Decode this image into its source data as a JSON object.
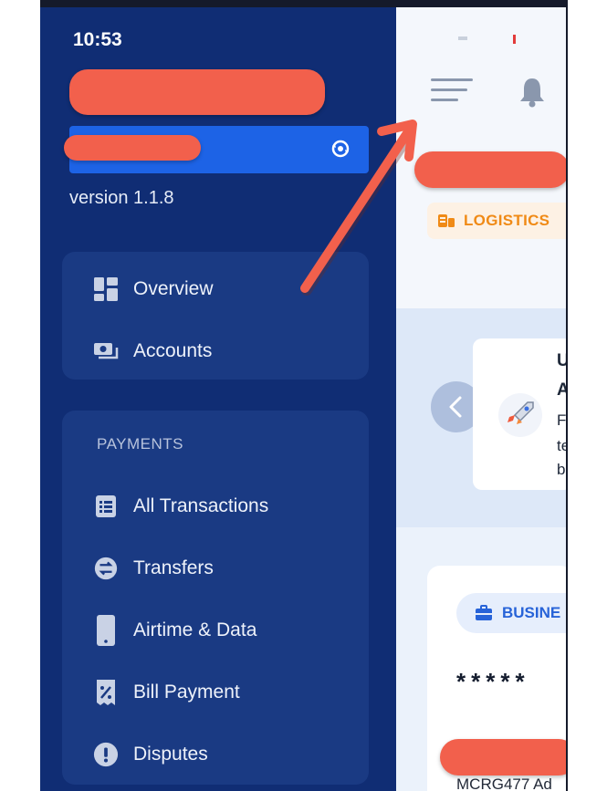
{
  "status_bar": {
    "time": "10:53"
  },
  "sidebar": {
    "version": "version 1.1.8",
    "nav_top": [
      {
        "label": "Overview",
        "icon": "dashboard-icon"
      },
      {
        "label": "Accounts",
        "icon": "accounts-icon"
      }
    ],
    "payments": {
      "title": "PAYMENTS",
      "items": [
        {
          "label": "All Transactions",
          "icon": "list-icon"
        },
        {
          "label": "Transfers",
          "icon": "transfer-icon"
        },
        {
          "label": "Airtime & Data",
          "icon": "phone-icon"
        },
        {
          "label": "Bill Payment",
          "icon": "receipt-icon"
        },
        {
          "label": "Disputes",
          "icon": "alert-icon"
        }
      ]
    }
  },
  "main": {
    "category_badge": "LOGISTICS",
    "promo_lines": [
      "U",
      "A",
      "F",
      "te",
      "b"
    ],
    "balance": {
      "pill_label": "BUSINE",
      "masked_balance": "*****",
      "account_text": "MCRG477 Ad"
    }
  },
  "colors": {
    "sidebar_bg": "#102d74",
    "card_bg": "#1a3a83",
    "accent_blue": "#1d63e6",
    "redaction": "#f2604c",
    "logistics_orange": "#f08a16"
  }
}
